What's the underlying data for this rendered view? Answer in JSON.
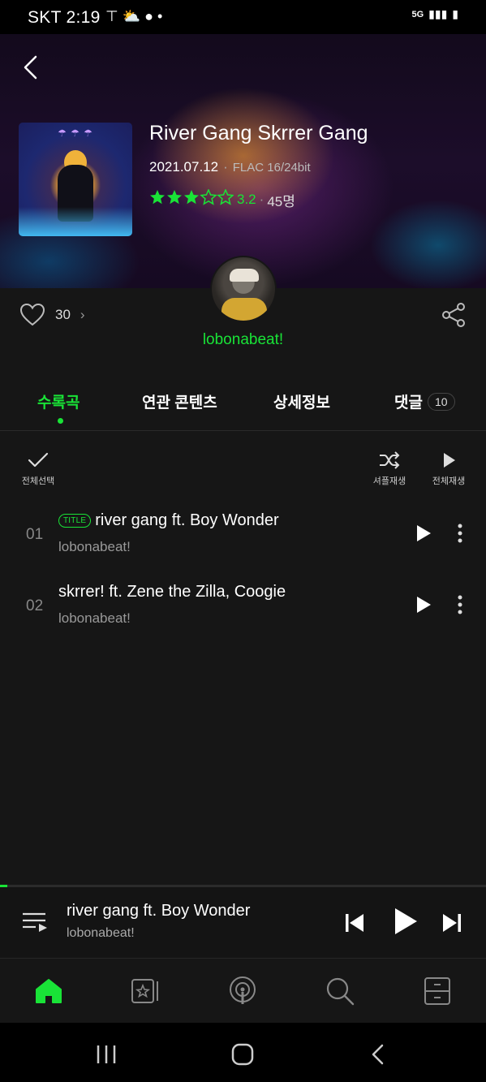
{
  "status_bar": {
    "carrier_time": "SKT 2:19",
    "network": "5G"
  },
  "album": {
    "title": "River Gang Skrrer Gang",
    "date": "2021.07.12",
    "format": "FLAC 16/24bit",
    "rating": "3.2",
    "rating_count": "45명",
    "stars": 3.5,
    "likes": "30",
    "artist": "lobonabeat!"
  },
  "tabs": [
    {
      "label": "수록곡",
      "active": true
    },
    {
      "label": "연관 콘텐츠",
      "active": false
    },
    {
      "label": "상세정보",
      "active": false
    },
    {
      "label": "댓글",
      "active": false,
      "badge": "10"
    }
  ],
  "actions": {
    "select_all": "전체선택",
    "shuffle": "셔플재생",
    "play_all": "전체재생"
  },
  "tracks": [
    {
      "num": "01",
      "badge": "TITLE",
      "name": "river gang ft. Boy Wonder",
      "artist": "lobonabeat!"
    },
    {
      "num": "02",
      "badge": "",
      "name": "skrrer! ft. Zene the Zilla, Coogie",
      "artist": "lobonabeat!"
    }
  ],
  "now_playing": {
    "title": "river gang ft. Boy Wonder",
    "artist": "lobonabeat!",
    "progress": 0.015
  },
  "colors": {
    "accent": "#19e337",
    "background": "#161616"
  }
}
